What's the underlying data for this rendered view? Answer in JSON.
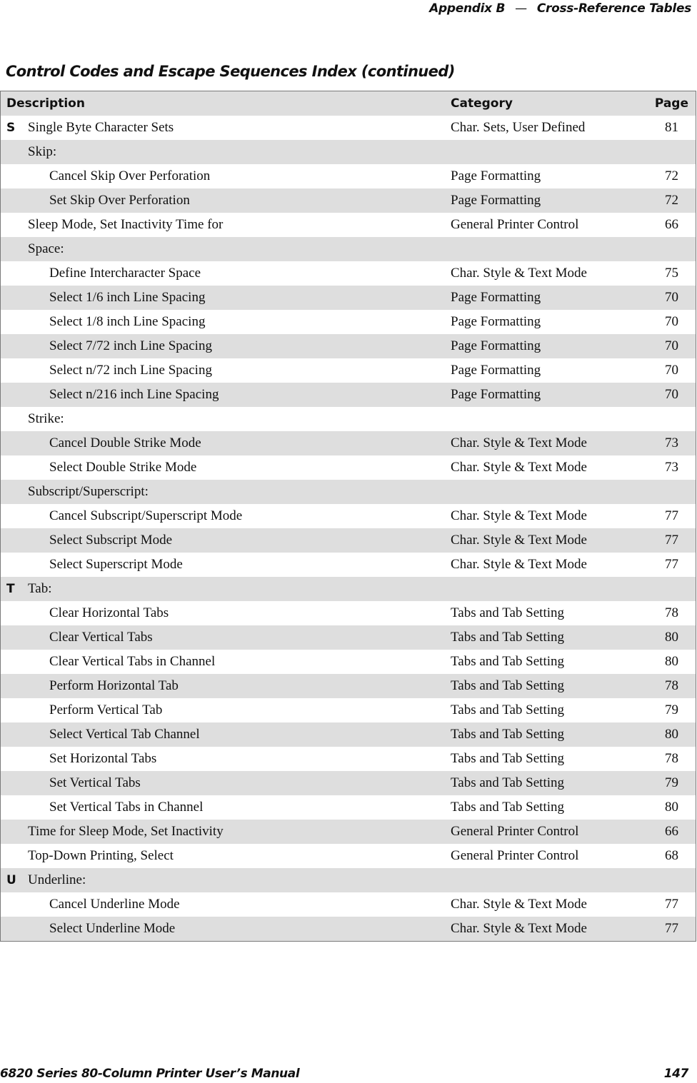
{
  "running_head": {
    "section": "Appendix B",
    "separator": "—",
    "chapter": "Cross-Reference Tables"
  },
  "table": {
    "title": "Control Codes and Escape Sequences Index (continued)",
    "columns": [
      "Description",
      "Category",
      "Page"
    ],
    "rows": [
      {
        "letter": "S",
        "description": "Single Byte Character Sets",
        "indent": false,
        "category": "Char. Sets, User Defined",
        "page": "81"
      },
      {
        "letter": "",
        "description": "Skip:",
        "indent": false,
        "category": "",
        "page": ""
      },
      {
        "letter": "",
        "description": "Cancel Skip Over Perforation",
        "indent": true,
        "category": "Page Formatting",
        "page": "72"
      },
      {
        "letter": "",
        "description": "Set Skip Over Perforation",
        "indent": true,
        "category": "Page Formatting",
        "page": "72"
      },
      {
        "letter": "",
        "description": "Sleep Mode, Set Inactivity Time for",
        "indent": false,
        "category": "General Printer Control",
        "page": "66"
      },
      {
        "letter": "",
        "description": "Space:",
        "indent": false,
        "category": "",
        "page": ""
      },
      {
        "letter": "",
        "description": "Define Intercharacter Space",
        "indent": true,
        "category": "Char. Style & Text Mode",
        "page": "75"
      },
      {
        "letter": "",
        "description": "Select 1/6 inch Line Spacing",
        "indent": true,
        "category": "Page Formatting",
        "page": "70"
      },
      {
        "letter": "",
        "description": "Select 1/8 inch Line Spacing",
        "indent": true,
        "category": "Page Formatting",
        "page": "70"
      },
      {
        "letter": "",
        "description": "Select 7/72 inch Line Spacing",
        "indent": true,
        "category": "Page Formatting",
        "page": "70"
      },
      {
        "letter": "",
        "description": "Select n/72 inch Line Spacing",
        "indent": true,
        "category": "Page Formatting",
        "page": "70"
      },
      {
        "letter": "",
        "description": "Select n/216 inch Line Spacing",
        "indent": true,
        "category": "Page Formatting",
        "page": "70"
      },
      {
        "letter": "",
        "description": "Strike:",
        "indent": false,
        "category": "",
        "page": ""
      },
      {
        "letter": "",
        "description": "Cancel Double Strike Mode",
        "indent": true,
        "category": "Char. Style & Text Mode",
        "page": "73"
      },
      {
        "letter": "",
        "description": "Select Double Strike Mode",
        "indent": true,
        "category": "Char. Style & Text Mode",
        "page": "73"
      },
      {
        "letter": "",
        "description": "Subscript/Superscript:",
        "indent": false,
        "category": "",
        "page": ""
      },
      {
        "letter": "",
        "description": "Cancel Subscript/Superscript Mode",
        "indent": true,
        "category": "Char. Style & Text Mode",
        "page": "77"
      },
      {
        "letter": "",
        "description": "Select Subscript Mode",
        "indent": true,
        "category": "Char. Style & Text Mode",
        "page": "77"
      },
      {
        "letter": "",
        "description": "Select Superscript Mode",
        "indent": true,
        "category": "Char. Style & Text Mode",
        "page": "77"
      },
      {
        "letter": "T",
        "description": "Tab:",
        "indent": false,
        "category": "",
        "page": ""
      },
      {
        "letter": "",
        "description": "Clear Horizontal Tabs",
        "indent": true,
        "category": "Tabs and Tab Setting",
        "page": "78"
      },
      {
        "letter": "",
        "description": "Clear Vertical Tabs",
        "indent": true,
        "category": "Tabs and Tab Setting",
        "page": "80"
      },
      {
        "letter": "",
        "description": "Clear Vertical Tabs in Channel",
        "indent": true,
        "category": "Tabs and Tab Setting",
        "page": "80"
      },
      {
        "letter": "",
        "description": "Perform Horizontal Tab",
        "indent": true,
        "category": "Tabs and Tab Setting",
        "page": "78"
      },
      {
        "letter": "",
        "description": "Perform Vertical Tab",
        "indent": true,
        "category": "Tabs and Tab Setting",
        "page": "79"
      },
      {
        "letter": "",
        "description": "Select Vertical Tab Channel",
        "indent": true,
        "category": "Tabs and Tab Setting",
        "page": "80"
      },
      {
        "letter": "",
        "description": "Set Horizontal Tabs",
        "indent": true,
        "category": "Tabs and Tab Setting",
        "page": "78"
      },
      {
        "letter": "",
        "description": "Set Vertical Tabs",
        "indent": true,
        "category": "Tabs and Tab Setting",
        "page": "79"
      },
      {
        "letter": "",
        "description": "Set Vertical Tabs in Channel",
        "indent": true,
        "category": "Tabs and Tab Setting",
        "page": "80"
      },
      {
        "letter": "",
        "description": "Time for Sleep Mode, Set Inactivity",
        "indent": false,
        "category": "General Printer Control",
        "page": "66"
      },
      {
        "letter": "",
        "description": "Top-Down Printing, Select",
        "indent": false,
        "category": "General Printer Control",
        "page": "68"
      },
      {
        "letter": "U",
        "description": "Underline:",
        "indent": false,
        "category": "",
        "page": ""
      },
      {
        "letter": "",
        "description": "Cancel Underline Mode",
        "indent": true,
        "category": "Char. Style & Text Mode",
        "page": "77"
      },
      {
        "letter": "",
        "description": "Select Underline Mode",
        "indent": true,
        "category": "Char. Style & Text Mode",
        "page": "77"
      }
    ]
  },
  "footer": {
    "manual_title": "6820 Series 80-Column Printer User’s Manual",
    "page_number": "147"
  }
}
